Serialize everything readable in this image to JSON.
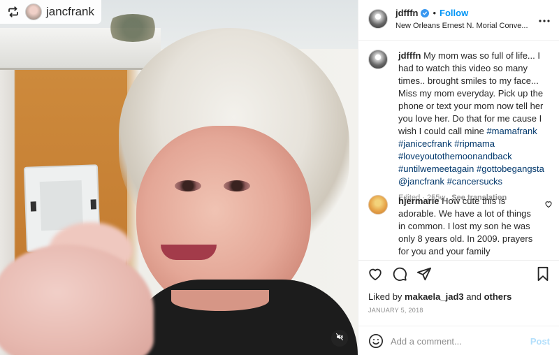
{
  "repost": {
    "username": "jancfrank"
  },
  "post": {
    "username": "jdfffn",
    "follow_label": "Follow",
    "location": "New Orleans Ernest N. Morial Conve...",
    "more_icon": "more-horizontal-icon"
  },
  "caption": {
    "username": "jdfffn",
    "text": "My mom was so full of life... I had to watch this video so many times.. brought smiles to my face... Miss my mom everyday. Pick up the phone or text your mom now tell her you love her. Do that for me cause I wish I could call mine",
    "hashtags": [
      "#mamafrank",
      "#janicecfrank",
      "#ripmama",
      "#loveyoutothemoonandback",
      "#untilwemeetagain",
      "#gottobegangsta",
      "@jancfrank",
      "#cancersucks"
    ],
    "edited_label": "Edited · 255w",
    "see_translation": "See translation"
  },
  "comments": [
    {
      "username": "hjermarie",
      "text": "How cute this is adorable. We have a lot of things in common. I lost my son he was only 8 years old. In 2009. prayers for you and your family"
    }
  ],
  "likes": {
    "prefix": "Liked by",
    "user": "makaela_jad3",
    "and": "and",
    "others": "others"
  },
  "date": "JANUARY 5, 2018",
  "add_comment": {
    "placeholder": "Add a comment...",
    "post_label": "Post"
  },
  "colors": {
    "link_blue": "#0095f6",
    "hashtag": "#00376b",
    "muted": "#8e8e8e",
    "verified": "#3897f0",
    "post_disabled": "#b2dffc"
  }
}
